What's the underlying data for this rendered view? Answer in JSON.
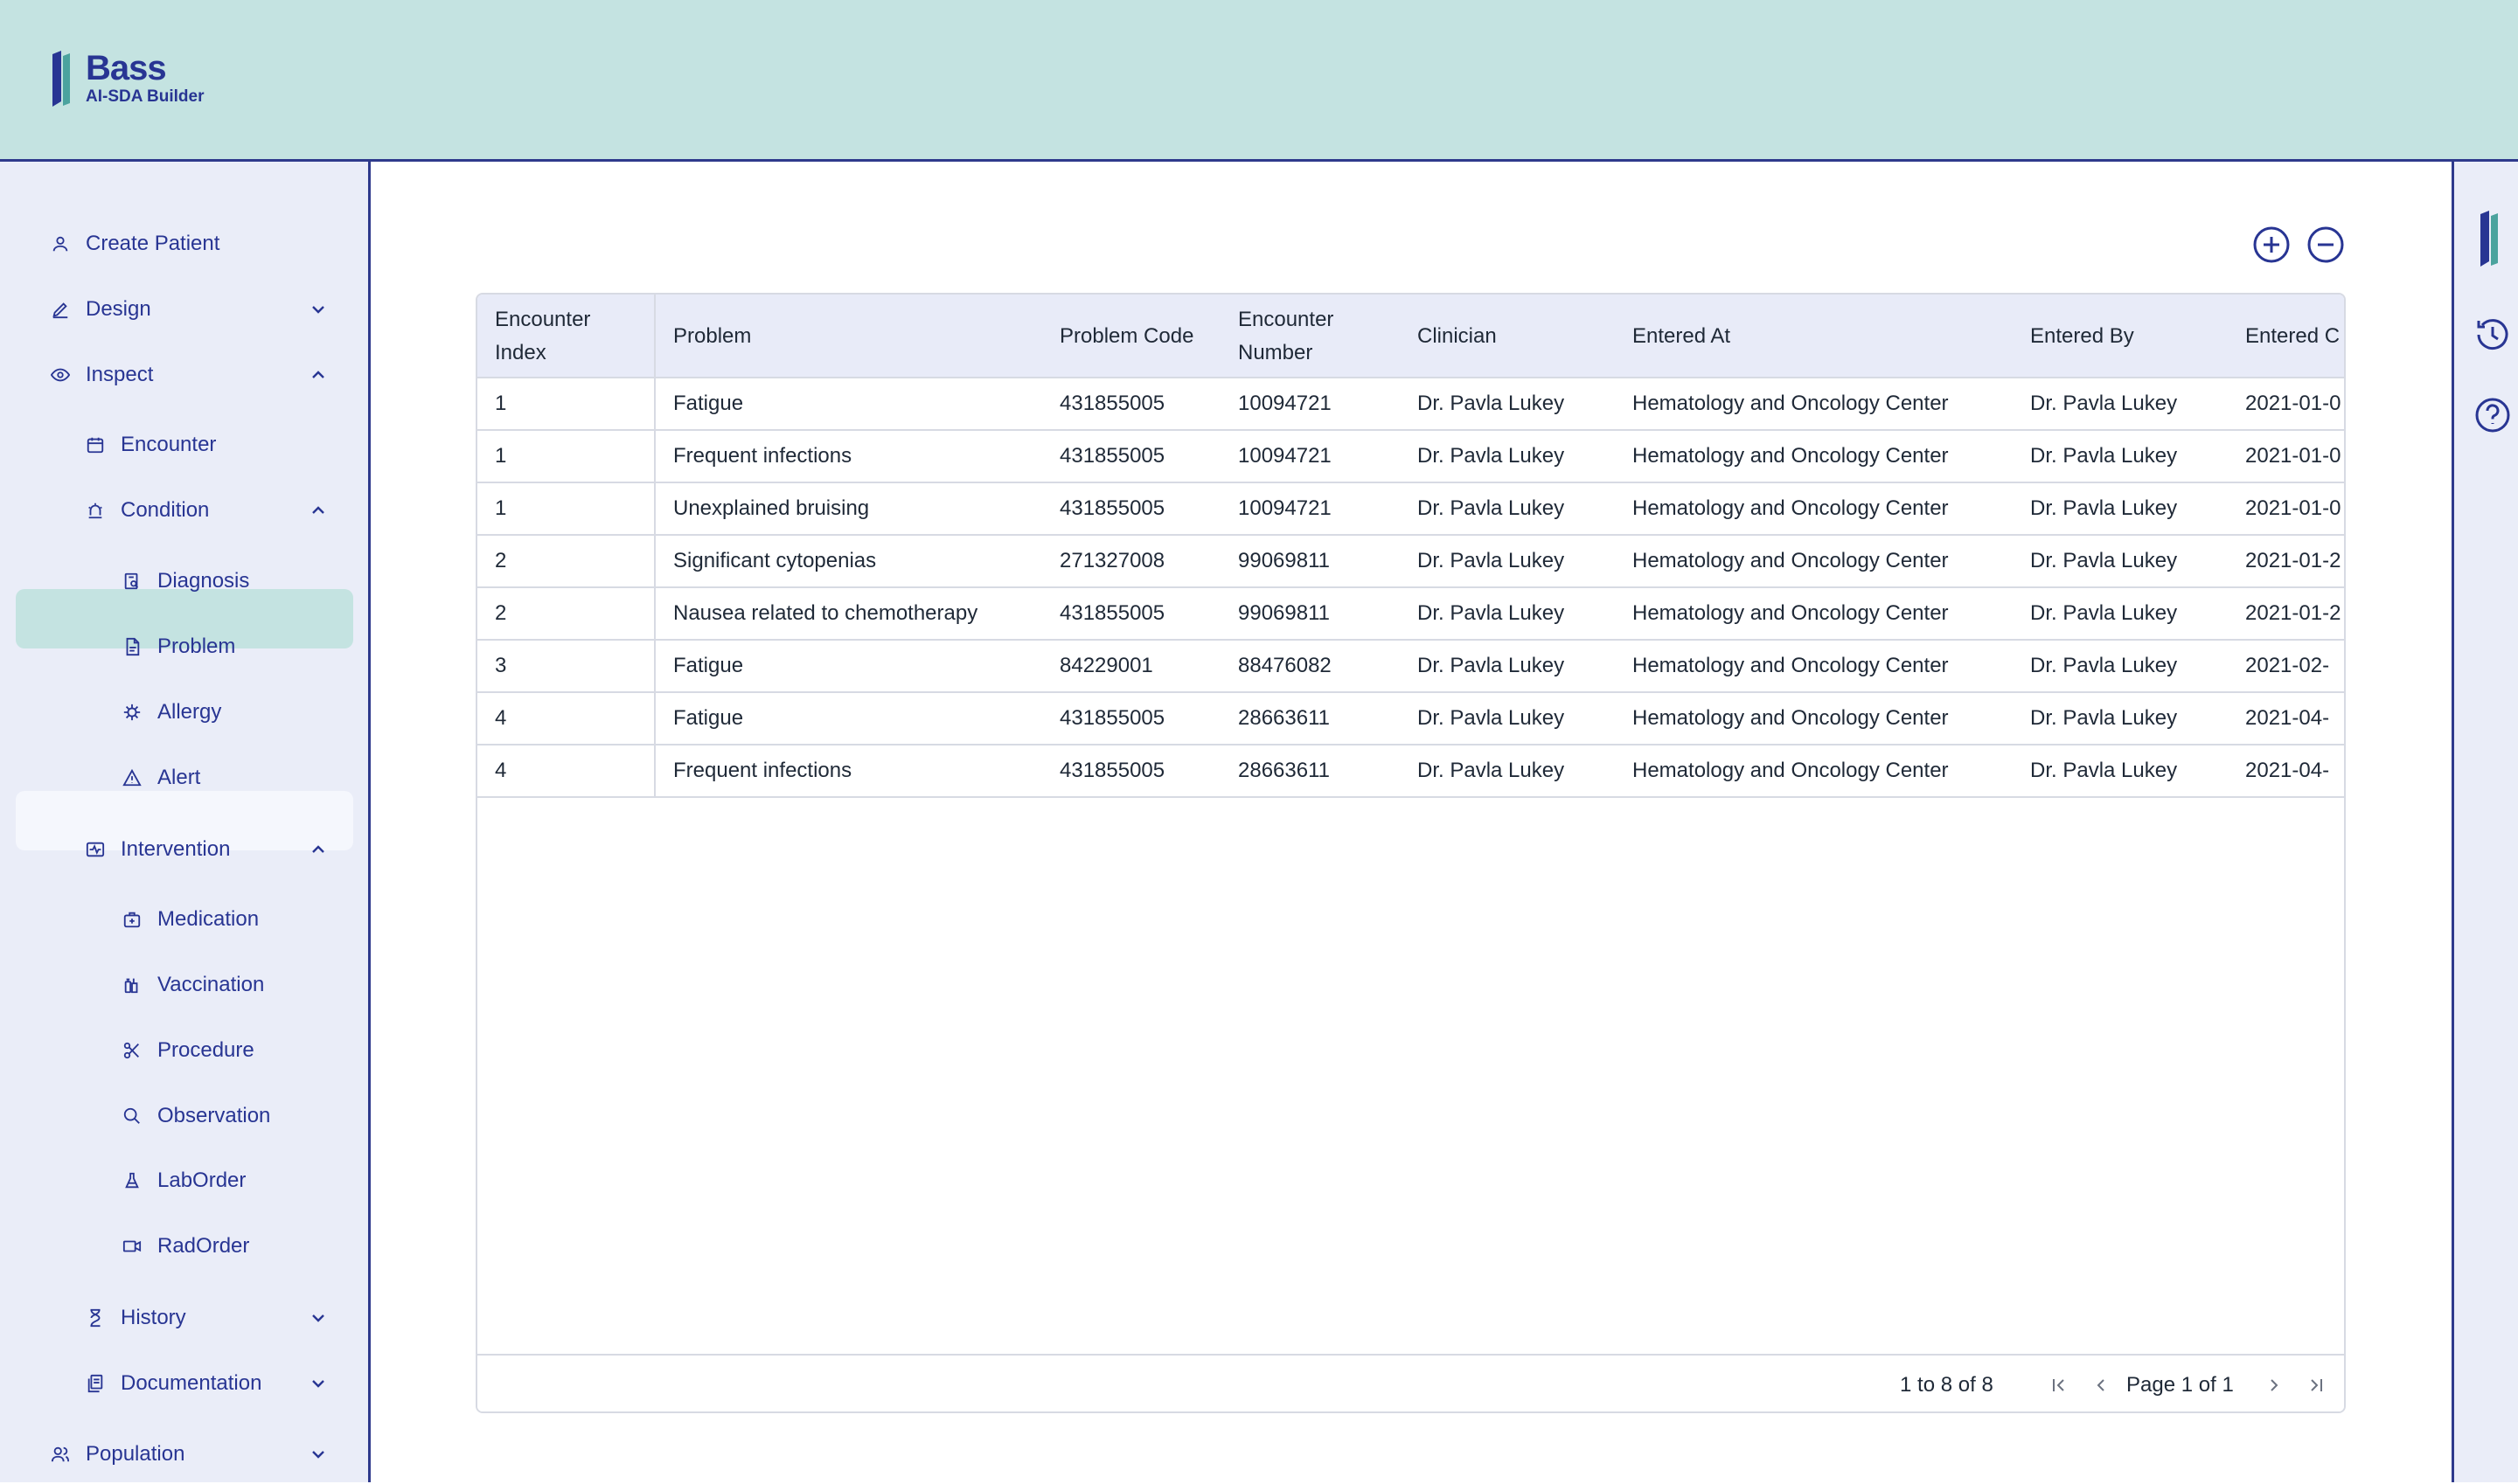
{
  "app": {
    "name": "Bass",
    "subtitle": "AI-SDA Builder",
    "brand_color": "#283593",
    "header_color": "#c4e3e1"
  },
  "sidebar": {
    "create_patient": "Create Patient",
    "design": "Design",
    "inspect": "Inspect",
    "encounter": "Encounter",
    "condition": "Condition",
    "diagnosis": "Diagnosis",
    "problem": "Problem",
    "allergy": "Allergy",
    "alert": "Alert",
    "intervention": "Intervention",
    "medication": "Medication",
    "vaccination": "Vaccination",
    "procedure": "Procedure",
    "observation": "Observation",
    "laborder": "LabOrder",
    "radorder": "RadOrder",
    "history": "History",
    "documentation": "Documentation",
    "population": "Population",
    "active_item": "Problem"
  },
  "table": {
    "columns": [
      "Encounter Index",
      "Problem",
      "Problem Code",
      "Encounter Number",
      "Clinician",
      "Entered At",
      "Entered By",
      "Entered C"
    ],
    "column_lines": [
      [
        "Encounter",
        "Index"
      ],
      [
        "Problem"
      ],
      [
        "Problem Code"
      ],
      [
        "Encounter",
        "Number"
      ],
      [
        "Clinician"
      ],
      [
        "Entered At"
      ],
      [
        "Entered By"
      ],
      [
        "Entered C"
      ]
    ],
    "rows": [
      [
        "1",
        "Fatigue",
        "431855005",
        "10094721",
        "Dr. Pavla Lukey",
        "Hematology and Oncology Center",
        "Dr. Pavla Lukey",
        "2021-01-0"
      ],
      [
        "1",
        "Frequent infections",
        "431855005",
        "10094721",
        "Dr. Pavla Lukey",
        "Hematology and Oncology Center",
        "Dr. Pavla Lukey",
        "2021-01-0"
      ],
      [
        "1",
        "Unexplained bruising",
        "431855005",
        "10094721",
        "Dr. Pavla Lukey",
        "Hematology and Oncology Center",
        "Dr. Pavla Lukey",
        "2021-01-0"
      ],
      [
        "2",
        "Significant cytopenias",
        "271327008",
        "99069811",
        "Dr. Pavla Lukey",
        "Hematology and Oncology Center",
        "Dr. Pavla Lukey",
        "2021-01-2"
      ],
      [
        "2",
        "Nausea related to chemotherapy",
        "431855005",
        "99069811",
        "Dr. Pavla Lukey",
        "Hematology and Oncology Center",
        "Dr. Pavla Lukey",
        "2021-01-2"
      ],
      [
        "3",
        "Fatigue",
        "84229001",
        "88476082",
        "Dr. Pavla Lukey",
        "Hematology and Oncology Center",
        "Dr. Pavla Lukey",
        "2021-02-"
      ],
      [
        "4",
        "Fatigue",
        "431855005",
        "28663611",
        "Dr. Pavla Lukey",
        "Hematology and Oncology Center",
        "Dr. Pavla Lukey",
        "2021-04-"
      ],
      [
        "4",
        "Frequent infections",
        "431855005",
        "28663611",
        "Dr. Pavla Lukey",
        "Hematology and Oncology Center",
        "Dr. Pavla Lukey",
        "2021-04-"
      ]
    ]
  },
  "pagination": {
    "summary_from": "1",
    "summary_to_word": "to",
    "summary_to": "8",
    "summary_of_word": "of",
    "summary_total": "8",
    "page_word": "Page",
    "page_current": "1",
    "page_of_word": "of",
    "page_total": "1"
  },
  "icons": {
    "zoom_in": "plus-circle-icon",
    "zoom_out": "minus-circle-icon",
    "history": "clock-history-icon",
    "help": "help-circle-icon"
  }
}
